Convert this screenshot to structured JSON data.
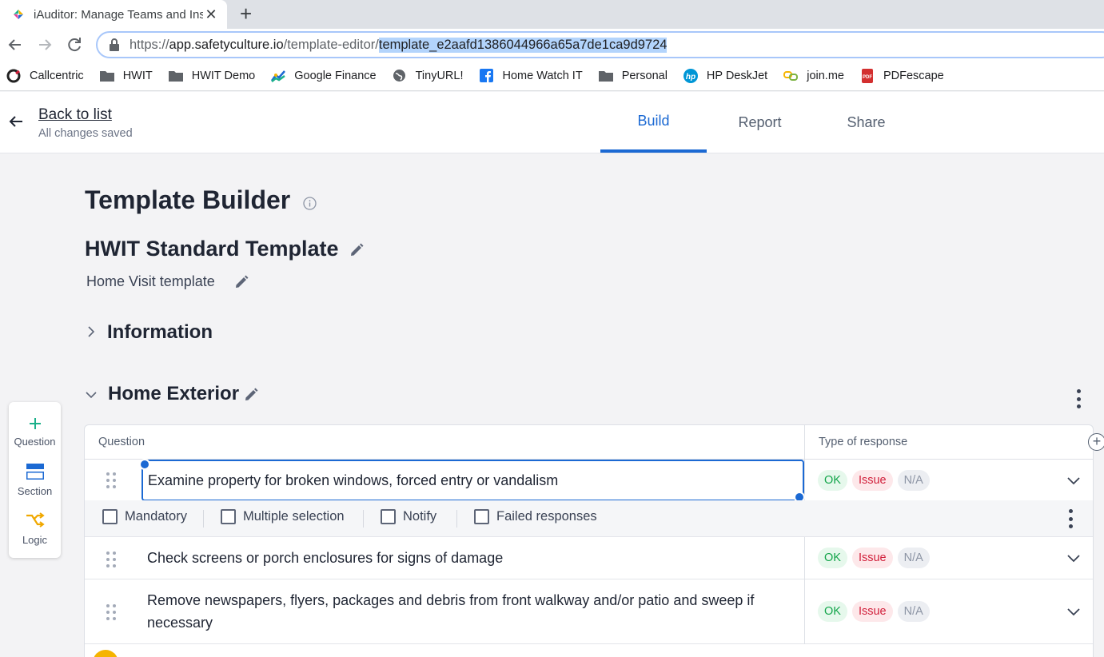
{
  "browser": {
    "tab_title": "iAuditor: Manage Teams and Inspections",
    "url_scheme": "https://",
    "url_host": "app.safetyculture.io",
    "url_path": "/template-editor/",
    "url_selected": "template_e2aafd1386044966a65a7de1ca9d9724",
    "bookmarks": [
      {
        "label": "Callcentric",
        "icon": "callcentric-icon"
      },
      {
        "label": "HWIT",
        "icon": "folder-icon"
      },
      {
        "label": "HWIT Demo",
        "icon": "folder-icon"
      },
      {
        "label": "Google Finance",
        "icon": "google-finance-icon"
      },
      {
        "label": "TinyURL!",
        "icon": "globe-icon"
      },
      {
        "label": "Home Watch IT",
        "icon": "facebook-icon"
      },
      {
        "label": "Personal",
        "icon": "folder-icon"
      },
      {
        "label": "HP DeskJet",
        "icon": "hp-icon"
      },
      {
        "label": "join.me",
        "icon": "joinme-icon"
      },
      {
        "label": "PDFescape",
        "icon": "pdf-icon"
      }
    ]
  },
  "header": {
    "back_label": "Back to list",
    "status": "All changes saved",
    "tabs": [
      {
        "label": "Build",
        "active": true
      },
      {
        "label": "Report",
        "active": false
      },
      {
        "label": "Share",
        "active": false
      }
    ]
  },
  "sidetools": {
    "question": "Question",
    "section": "Section",
    "logic": "Logic"
  },
  "main": {
    "page_title": "Template Builder",
    "template_name": "HWIT Standard Template",
    "template_description": "Home Visit template",
    "sections": [
      {
        "title": "Information",
        "expanded": false
      },
      {
        "title": "Home Exterior",
        "expanded": true
      }
    ],
    "table": {
      "col_question": "Question",
      "col_type": "Type of response",
      "options": {
        "mandatory": "Mandatory",
        "multiple": "Multiple selection",
        "notify": "Notify",
        "failed": "Failed responses"
      },
      "rows": [
        {
          "question": "Examine property for broken windows, forced entry or vandalism",
          "ok": "OK",
          "issue": "Issue",
          "na": "N/A"
        },
        {
          "question": "Check screens or porch enclosures for signs of damage",
          "ok": "OK",
          "issue": "Issue",
          "na": "N/A"
        },
        {
          "question": "Remove newspapers, flyers, packages and debris from front walkway and/or patio and sweep if necessary",
          "ok": "OK",
          "issue": "Issue",
          "na": "N/A"
        }
      ]
    }
  },
  "colors": {
    "accent": "#1b69d3",
    "ok": "#13a54a",
    "issue": "#d11f3a",
    "question_add": "#1bb08a",
    "logic": "#f0a800"
  }
}
